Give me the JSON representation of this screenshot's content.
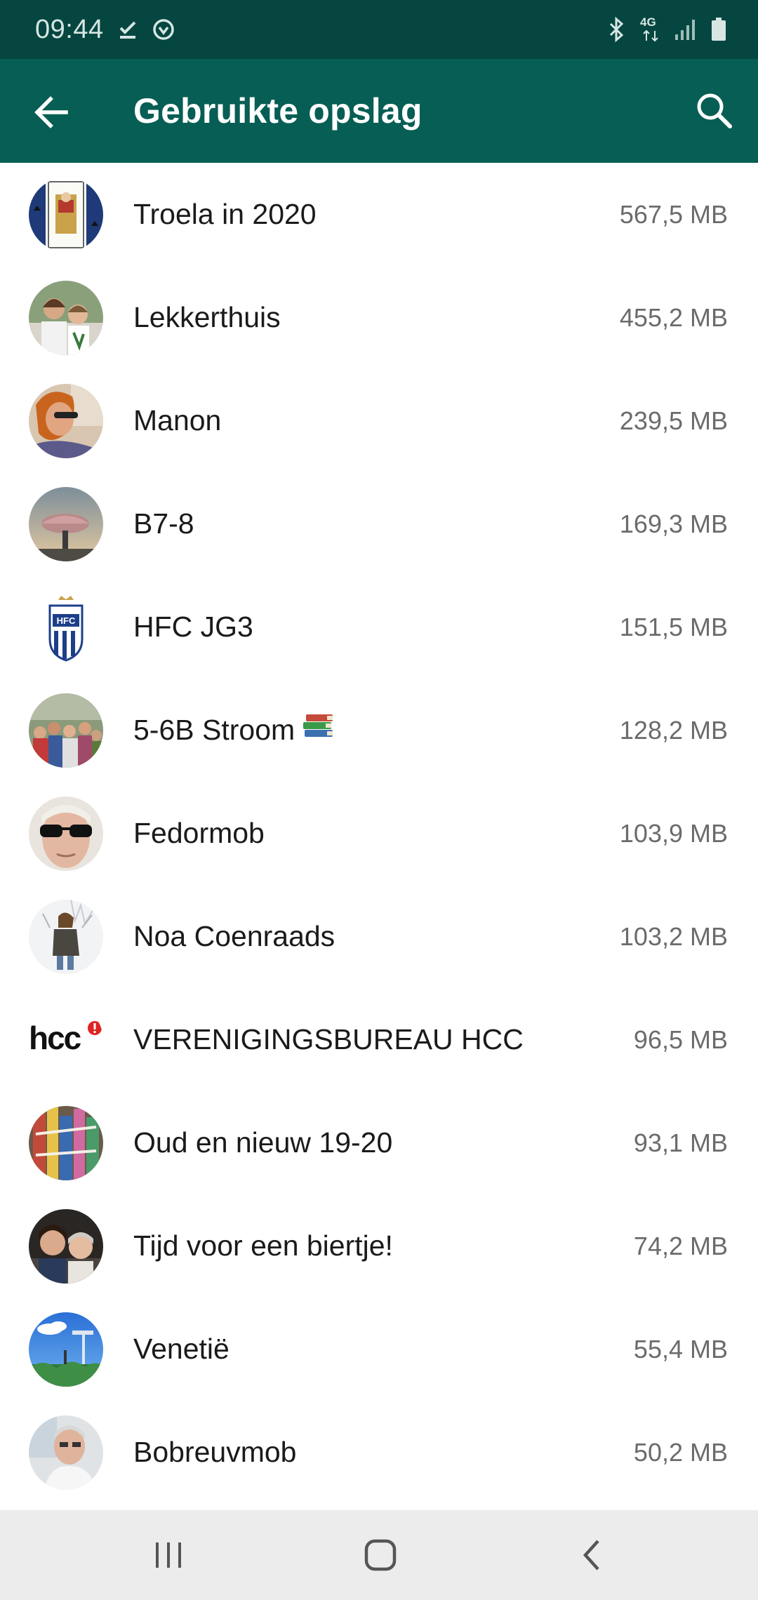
{
  "status_bar": {
    "time": "09:44",
    "network": "4G"
  },
  "app_bar": {
    "title": "Gebruikte opslag",
    "color": "#075e54"
  },
  "chats": [
    {
      "name": "Troela in 2020",
      "size": "567,5 MB",
      "avatar": "playing-card-avatar"
    },
    {
      "name": "Lekkerthuis",
      "size": "455,2 MB",
      "avatar": "group-photo-avatar"
    },
    {
      "name": "Manon",
      "size": "239,5 MB",
      "avatar": "person-photo-avatar"
    },
    {
      "name": "B7-8",
      "size": "169,3 MB",
      "avatar": "landscape-photo-avatar"
    },
    {
      "name": "HFC JG3",
      "size": "151,5 MB",
      "avatar": "club-crest-avatar"
    },
    {
      "name": "5-6B Stroom",
      "size": "128,2 MB",
      "avatar": "group-photo-avatar",
      "emoji": "books-emoji"
    },
    {
      "name": "Fedormob",
      "size": "103,9 MB",
      "avatar": "person-photo-avatar"
    },
    {
      "name": "Noa Coenraads",
      "size": "103,2 MB",
      "avatar": "person-photo-avatar"
    },
    {
      "name": "VERENIGINGSBUREAU HCC",
      "size": "96,5 MB",
      "avatar": "hcc-logo-avatar",
      "logo_text": "hcc"
    },
    {
      "name": "Oud en nieuw 19-20",
      "size": "93,1 MB",
      "avatar": "photo-avatar"
    },
    {
      "name": "Tijd voor een biertje!",
      "size": "74,2 MB",
      "avatar": "group-photo-avatar"
    },
    {
      "name": "Venetië",
      "size": "55,4 MB",
      "avatar": "landscape-photo-avatar"
    },
    {
      "name": "Bobreuvmob",
      "size": "50,2 MB",
      "avatar": "person-photo-avatar"
    }
  ]
}
